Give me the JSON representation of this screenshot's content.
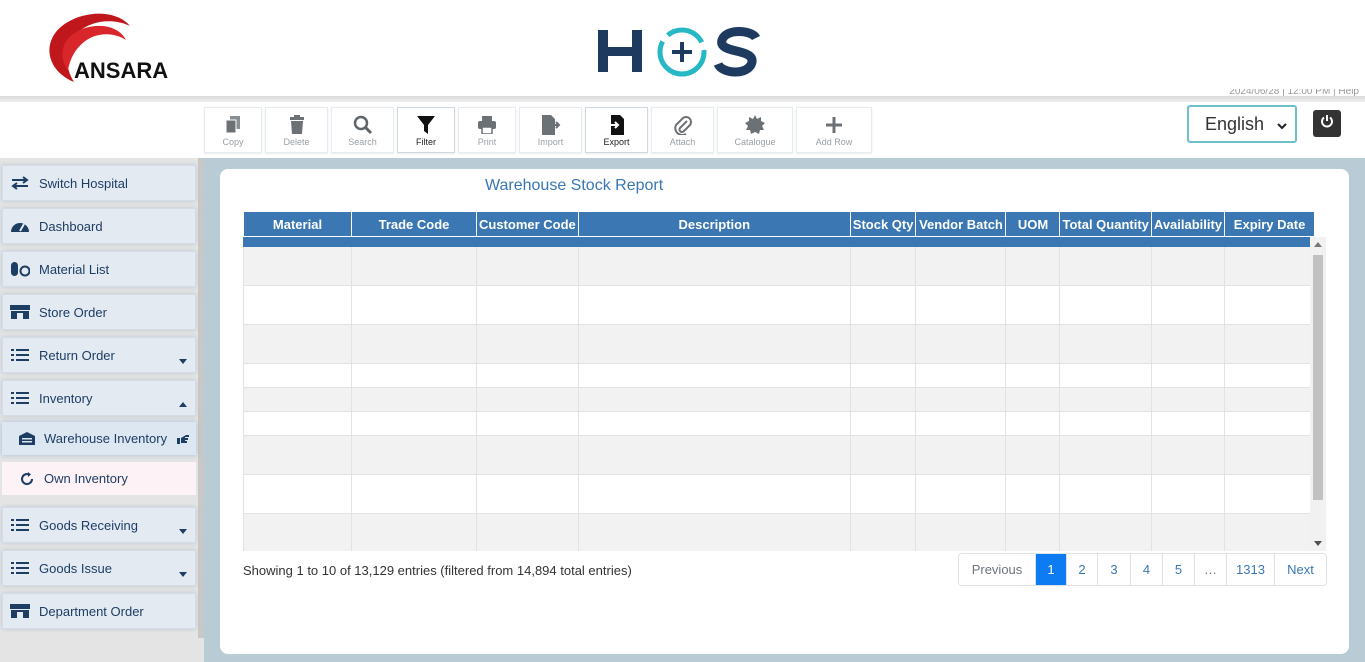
{
  "header": {
    "brand_left": "ANSARA",
    "right_text": "2024/06/28 | 12:00 PM | Help"
  },
  "toolbar": {
    "buttons": [
      {
        "label": "Copy",
        "icon": "copy-icon"
      },
      {
        "label": "Delete",
        "icon": "trash-icon"
      },
      {
        "label": "Search",
        "icon": "search-icon"
      },
      {
        "label": "Filter",
        "icon": "filter-icon"
      },
      {
        "label": "Print",
        "icon": "print-icon"
      },
      {
        "label": "Import",
        "icon": "import-icon"
      },
      {
        "label": "Export",
        "icon": "export-icon"
      },
      {
        "label": "Attach",
        "icon": "paperclip-icon"
      },
      {
        "label": "Catalogue",
        "icon": "badge-icon"
      },
      {
        "label": "Add Row",
        "icon": "plus-icon"
      }
    ],
    "language": "English"
  },
  "sidebar": {
    "items": [
      {
        "label": "Switch Hospital",
        "icon": "switch-arrows-icon"
      },
      {
        "label": "Dashboard",
        "icon": "dashboard-gauge-icon"
      },
      {
        "label": "Material List",
        "icon": "pills-icon"
      },
      {
        "label": "Store Order",
        "icon": "store-icon"
      },
      {
        "label": "Return Order",
        "icon": "list-icon"
      },
      {
        "label": "Inventory",
        "icon": "list-icon"
      },
      {
        "label": "Warehouse Inventory",
        "icon": "warehouse-icon"
      },
      {
        "label": "Own Inventory",
        "icon": "refresh-icon"
      },
      {
        "label": "Goods Receiving",
        "icon": "list-icon"
      },
      {
        "label": "Goods Issue",
        "icon": "list-icon"
      },
      {
        "label": "Department Order",
        "icon": "store-icon"
      }
    ]
  },
  "report": {
    "title": "Warehouse Stock Report",
    "columns": [
      "Material",
      "Trade Code",
      "Customer Code",
      "Description",
      "Stock Qty",
      "Vendor Batch",
      "UOM",
      "Total Quantity",
      "Availability",
      "Expiry Date"
    ],
    "info": "Showing 1 to 10 of 13,129 entries (filtered from 14,894 total entries)"
  },
  "pagination": {
    "previous": "Previous",
    "pages": [
      "1",
      "2",
      "3",
      "4",
      "5",
      "…",
      "1313"
    ],
    "next": "Next",
    "current": "1"
  },
  "colors": {
    "header_blue": "#3a77b3",
    "active_page": "#0d7bf2",
    "main_bg": "#b9ccd6"
  }
}
